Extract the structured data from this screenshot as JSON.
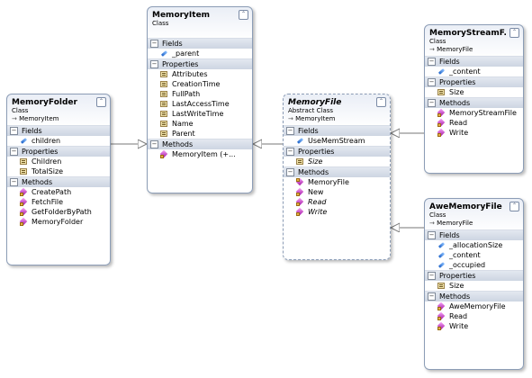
{
  "classes": [
    {
      "id": "memoryitem",
      "name": "MemoryItem",
      "kind": "Class",
      "base": "",
      "abstract": false,
      "sections": [
        {
          "title": "Fields",
          "members": [
            {
              "name": "_parent",
              "icon": "field-icon"
            }
          ]
        },
        {
          "title": "Properties",
          "members": [
            {
              "name": "Attributes",
              "icon": "property-icon"
            },
            {
              "name": "CreationTime",
              "icon": "property-icon"
            },
            {
              "name": "FullPath",
              "icon": "property-icon"
            },
            {
              "name": "LastAccessTime",
              "icon": "property-icon"
            },
            {
              "name": "LastWriteTime",
              "icon": "property-icon"
            },
            {
              "name": "Name",
              "icon": "property-icon"
            },
            {
              "name": "Parent",
              "icon": "property-icon"
            }
          ]
        },
        {
          "title": "Methods",
          "members": [
            {
              "name": "MemoryItem  (+...",
              "icon": "method-icon"
            }
          ]
        }
      ]
    },
    {
      "id": "memoryfolder",
      "name": "MemoryFolder",
      "kind": "Class",
      "base": "MemoryItem",
      "abstract": false,
      "sections": [
        {
          "title": "Fields",
          "members": [
            {
              "name": "children",
              "icon": "field-icon"
            }
          ]
        },
        {
          "title": "Properties",
          "members": [
            {
              "name": "Children",
              "icon": "property-icon"
            },
            {
              "name": "TotalSize",
              "icon": "property-icon"
            }
          ]
        },
        {
          "title": "Methods",
          "members": [
            {
              "name": "CreatePath",
              "icon": "method-icon"
            },
            {
              "name": "FetchFile",
              "icon": "method-icon"
            },
            {
              "name": "GetFolderByPath",
              "icon": "method-icon"
            },
            {
              "name": "MemoryFolder",
              "icon": "method-icon"
            }
          ]
        }
      ]
    },
    {
      "id": "memoryfile",
      "name": "MemoryFile",
      "kind": "Abstract Class",
      "base": "MemoryItem",
      "abstract": true,
      "sections": [
        {
          "title": "Fields",
          "members": [
            {
              "name": "UseMemStream",
              "icon": "field-icon"
            }
          ]
        },
        {
          "title": "Properties",
          "members": [
            {
              "name": "Size",
              "icon": "property-icon",
              "italic": true
            }
          ]
        },
        {
          "title": "Methods",
          "members": [
            {
              "name": "MemoryFile",
              "icon": "constructor-icon"
            },
            {
              "name": "New",
              "icon": "method-icon"
            },
            {
              "name": "Read",
              "icon": "method-icon",
              "italic": true
            },
            {
              "name": "Write",
              "icon": "method-icon",
              "italic": true
            }
          ]
        }
      ]
    },
    {
      "id": "memorystreamfile",
      "name": "MemoryStreamF...",
      "kind": "Class",
      "base": "MemoryFile",
      "abstract": false,
      "sections": [
        {
          "title": "Fields",
          "members": [
            {
              "name": "_content",
              "icon": "field-icon"
            }
          ]
        },
        {
          "title": "Properties",
          "members": [
            {
              "name": "Size",
              "icon": "property-icon"
            }
          ]
        },
        {
          "title": "Methods",
          "members": [
            {
              "name": "MemoryStreamFile",
              "icon": "method-icon"
            },
            {
              "name": "Read",
              "icon": "method-icon"
            },
            {
              "name": "Write",
              "icon": "method-icon"
            }
          ]
        }
      ]
    },
    {
      "id": "awememoryfile",
      "name": "AweMemoryFile",
      "kind": "Class",
      "base": "MemoryFile",
      "abstract": false,
      "sections": [
        {
          "title": "Fields",
          "members": [
            {
              "name": "_allocationSize",
              "icon": "field-icon"
            },
            {
              "name": "_content",
              "icon": "field-icon"
            },
            {
              "name": "_occupied",
              "icon": "field-icon"
            }
          ]
        },
        {
          "title": "Properties",
          "members": [
            {
              "name": "Size",
              "icon": "property-icon"
            }
          ]
        },
        {
          "title": "Methods",
          "members": [
            {
              "name": "AweMemoryFile",
              "icon": "method-icon"
            },
            {
              "name": "Read",
              "icon": "method-icon"
            },
            {
              "name": "Write",
              "icon": "method-icon"
            }
          ]
        }
      ]
    }
  ],
  "inheritance": [
    {
      "from": "memoryfolder",
      "to": "memoryitem"
    },
    {
      "from": "memoryfile",
      "to": "memoryitem"
    },
    {
      "from": "memorystreamfile",
      "to": "memoryfile"
    },
    {
      "from": "awememoryfile",
      "to": "memoryfile"
    }
  ]
}
